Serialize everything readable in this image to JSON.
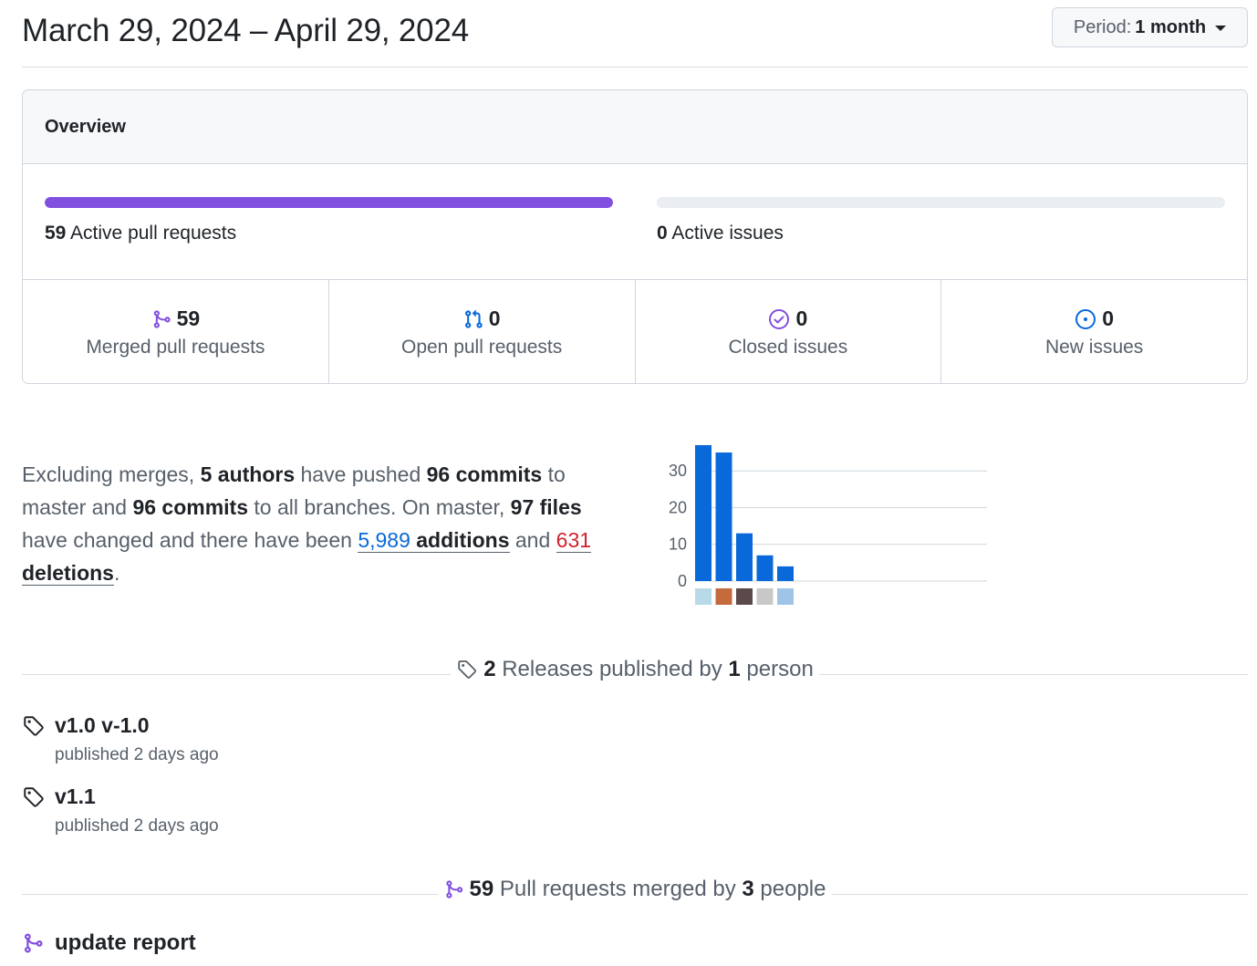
{
  "header": {
    "date_range": "March 29, 2024 – April 29, 2024",
    "period_label": "Period:",
    "period_value": "1 month"
  },
  "overview": {
    "title": "Overview",
    "active_prs": {
      "count": "59",
      "label": "Active pull requests",
      "fill": 1.0,
      "color": "#8250df"
    },
    "active_issues": {
      "count": "0",
      "label": "Active issues",
      "fill": 0.0
    },
    "stats": [
      {
        "icon": "git-merge-icon",
        "value": "59",
        "label": "Merged pull requests",
        "color": "#8250df"
      },
      {
        "icon": "git-pull-request-icon",
        "value": "0",
        "label": "Open pull requests",
        "color": "#0969da"
      },
      {
        "icon": "issue-closed-icon",
        "value": "0",
        "label": "Closed issues",
        "color": "#8250df"
      },
      {
        "icon": "issue-opened-icon",
        "value": "0",
        "label": "New issues",
        "color": "#0969da"
      }
    ]
  },
  "commits": {
    "t1": "Excluding merges, ",
    "authors": "5 authors",
    "t2": " have pushed ",
    "commits_master": "96 commits",
    "t3": " to master and ",
    "commits_all": "96 commits",
    "t4": " to all branches. On master, ",
    "files": "97 files",
    "t5": " have changed and there have been ",
    "additions_num": "5,989",
    "additions_word": " additions",
    "t6": " and ",
    "deletions_num": "631",
    "deletions_word": " deletions",
    "t7": "."
  },
  "chart_data": {
    "type": "bar",
    "categories": [
      "author-1",
      "author-2",
      "author-3",
      "author-4",
      "author-5"
    ],
    "values": [
      37,
      35,
      13,
      7,
      4
    ],
    "ylim": [
      0,
      37
    ],
    "yticks": [
      "0",
      "10",
      "20",
      "30"
    ],
    "bar_color": "#0969da",
    "grid": true
  },
  "releases": {
    "count": "2",
    "text1": " Releases published by ",
    "people": "1",
    "text2": " person",
    "items": [
      {
        "name": "v1.0 v-1.0",
        "meta": "published 2 days ago"
      },
      {
        "name": "v1.1",
        "meta": "published 2 days ago"
      }
    ]
  },
  "pulls": {
    "count": "59",
    "text1": " Pull requests merged by ",
    "people": "3",
    "text2": " people",
    "items": [
      {
        "title": "update report"
      }
    ]
  }
}
